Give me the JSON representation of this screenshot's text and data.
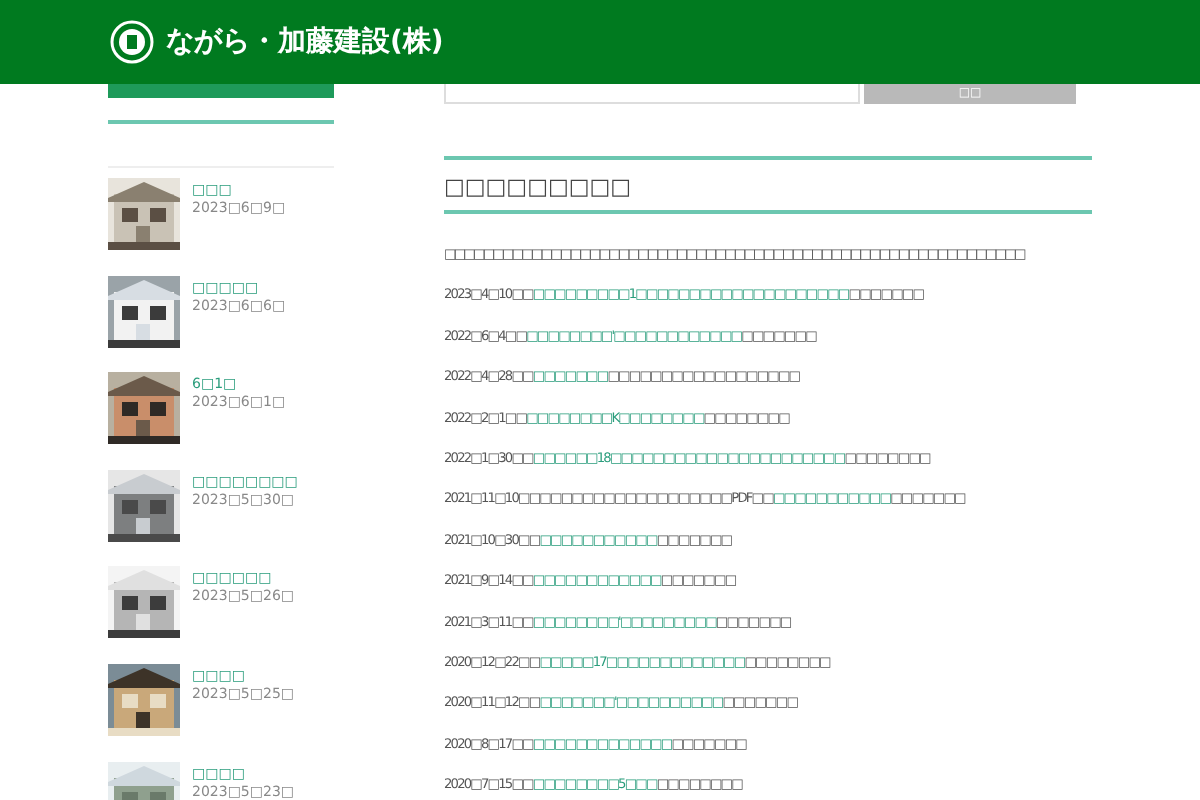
{
  "header": {
    "logo_text": "ながら・加藤建設(株)"
  },
  "search": {
    "button": "□□"
  },
  "sidebar": {
    "posts": [
      {
        "title": "□□□",
        "date": "2023□6□9□"
      },
      {
        "title": "□□□□□",
        "date": "2023□6□6□"
      },
      {
        "title": "6□1□",
        "date": "2023□6□1□"
      },
      {
        "title": "□□□□□□□□",
        "date": "2023□5□30□"
      },
      {
        "title": "□□□□□□",
        "date": "2023□5□26□"
      },
      {
        "title": "□□□□",
        "date": "2023□5□25□"
      },
      {
        "title": "□□□□",
        "date": "2023□5□23□"
      }
    ]
  },
  "main": {
    "heading": "□□□□□□□□□",
    "intro": "□□□□□□□□□□□□□□□□□□□□□□□□□□□□□□□□□□□□□□□□□□□□□□□□□□□□□□□□□□□□",
    "news": [
      {
        "prefix": "2023□4□10□□",
        "link": "□□□□□□□□□1□□□□□□□□□□□□□□□□□□□□",
        "suffix": "□□□□□□□"
      },
      {
        "prefix": "2022□6□4□□",
        "link": "□□□□□□□□'□□□□□□□□□□□□",
        "suffix": "□□□□□□□"
      },
      {
        "prefix": "2022□4□28□□",
        "link": "□□□□□□□",
        "suffix": "□□□□□□□□□□□□□□□□□□"
      },
      {
        "prefix": "2022□2□1□□",
        "link": "□□□□□□□□K□□□□□□□□",
        "suffix": "□□□□□□□□"
      },
      {
        "prefix": "2022□1□30□□",
        "link": "□□□□□□18□□□□□□□□□□□□□□□□□□□□□□",
        "suffix": "□□□□□□□□"
      },
      {
        "prefix": "2021□11□10□□□□□□□□□□□□□□□□□□□□PDF□□",
        "link": "□□□□□□□□□□□",
        "suffix": "□□□□□□□"
      },
      {
        "prefix": "2021□10□30□□",
        "link": "□□□□□□□□□□□",
        "suffix": "□□□□□□□"
      },
      {
        "prefix": "2021□9□14□□",
        "link": "□□□□□□□□□□□□",
        "suffix": "□□□□□□□"
      },
      {
        "prefix": "2021□3□11□□",
        "link": "□□□□□□□□'□□□□□□□□□",
        "suffix": "□□□□□□□"
      },
      {
        "prefix": "2020□12□22□□",
        "link": "□□□□□17□□□□□□□□□□□□□",
        "suffix": "□□□□□□□□"
      },
      {
        "prefix": "2020□11□12□□",
        "link": "□□□□□□□'□□□□□□□□□□",
        "suffix": "□□□□□□□"
      },
      {
        "prefix": "2020□8□17□□",
        "link": "□□□□□□□□□□□□□",
        "suffix": "□□□□□□□"
      },
      {
        "prefix": "2020□7□15□□",
        "link": "□□□□□□□□5□□□",
        "suffix": "□□□□□□□□"
      }
    ]
  }
}
